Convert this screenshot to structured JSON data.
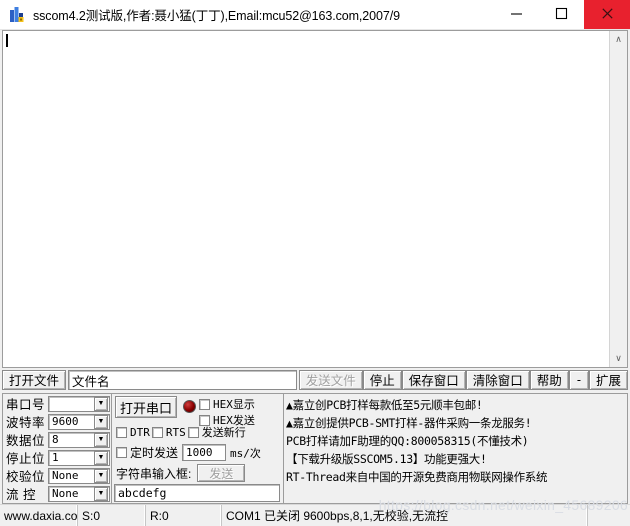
{
  "window": {
    "title": "sscom4.2测试版,作者:聂小猛(丁丁),Email:mcu52@163.com,2007/9",
    "icon": "sscom-app-icon",
    "minimize_glyph": "—",
    "maximize_glyph": "☐",
    "close_glyph": "✕",
    "close_color": "#e8212e"
  },
  "terminal": {
    "content": "",
    "scroll_up_glyph": "∧",
    "scroll_down_glyph": "∨"
  },
  "toolbar": {
    "open_file_label": "打开文件",
    "filename_value": "文件名",
    "send_file_label": "发送文件",
    "stop_label": "停止",
    "save_window_label": "保存窗口",
    "clear_window_label": "清除窗口",
    "help_label": "帮助",
    "minus_label": "-",
    "expand_label": "扩展"
  },
  "serial_params": [
    {
      "label": "串口号",
      "value": ""
    },
    {
      "label": "波特率",
      "value": "9600"
    },
    {
      "label": "数据位",
      "value": "8"
    },
    {
      "label": "停止位",
      "value": "1"
    },
    {
      "label": "校验位",
      "value": "None"
    },
    {
      "label": "流 控",
      "value": "None"
    }
  ],
  "combo_arrow_glyph": "▼",
  "controls": {
    "open_port_label": "打开串口",
    "led_state": "closed",
    "hex_display_label": "HEX显示",
    "hex_send_label": "HEX发送",
    "dtr_label": "DTR",
    "rts_label": "RTS",
    "send_newline_label": "发送新行",
    "timed_send_label": "定时发送",
    "timed_send_value": "1000",
    "timed_send_unit": "ms/次",
    "string_input_label": "字符串输入框:",
    "send_button_label": "发送",
    "string_input_value": "abcdefg"
  },
  "ads": [
    "▲嘉立创PCB打样每款低至5元顺丰包邮!",
    "▲嘉立创提供PCB-SMT打样-器件采购一条龙服务!",
    "PCB打样请加F助理的QQ:800058315(不懂技术)",
    "【下载升级版SSCOM5.13】功能更强大!",
    "RT-Thread来自中国的开源免费商用物联网操作系统"
  ],
  "statusbar": {
    "website": "www.daxia.cor",
    "sent": "S:0",
    "received": "R:0",
    "port_info": "COM1 已关闭  9600bps,8,1,无校验,无流控",
    "end": ""
  },
  "watermark": "https://blog.csdn.net/weixin_45689206"
}
